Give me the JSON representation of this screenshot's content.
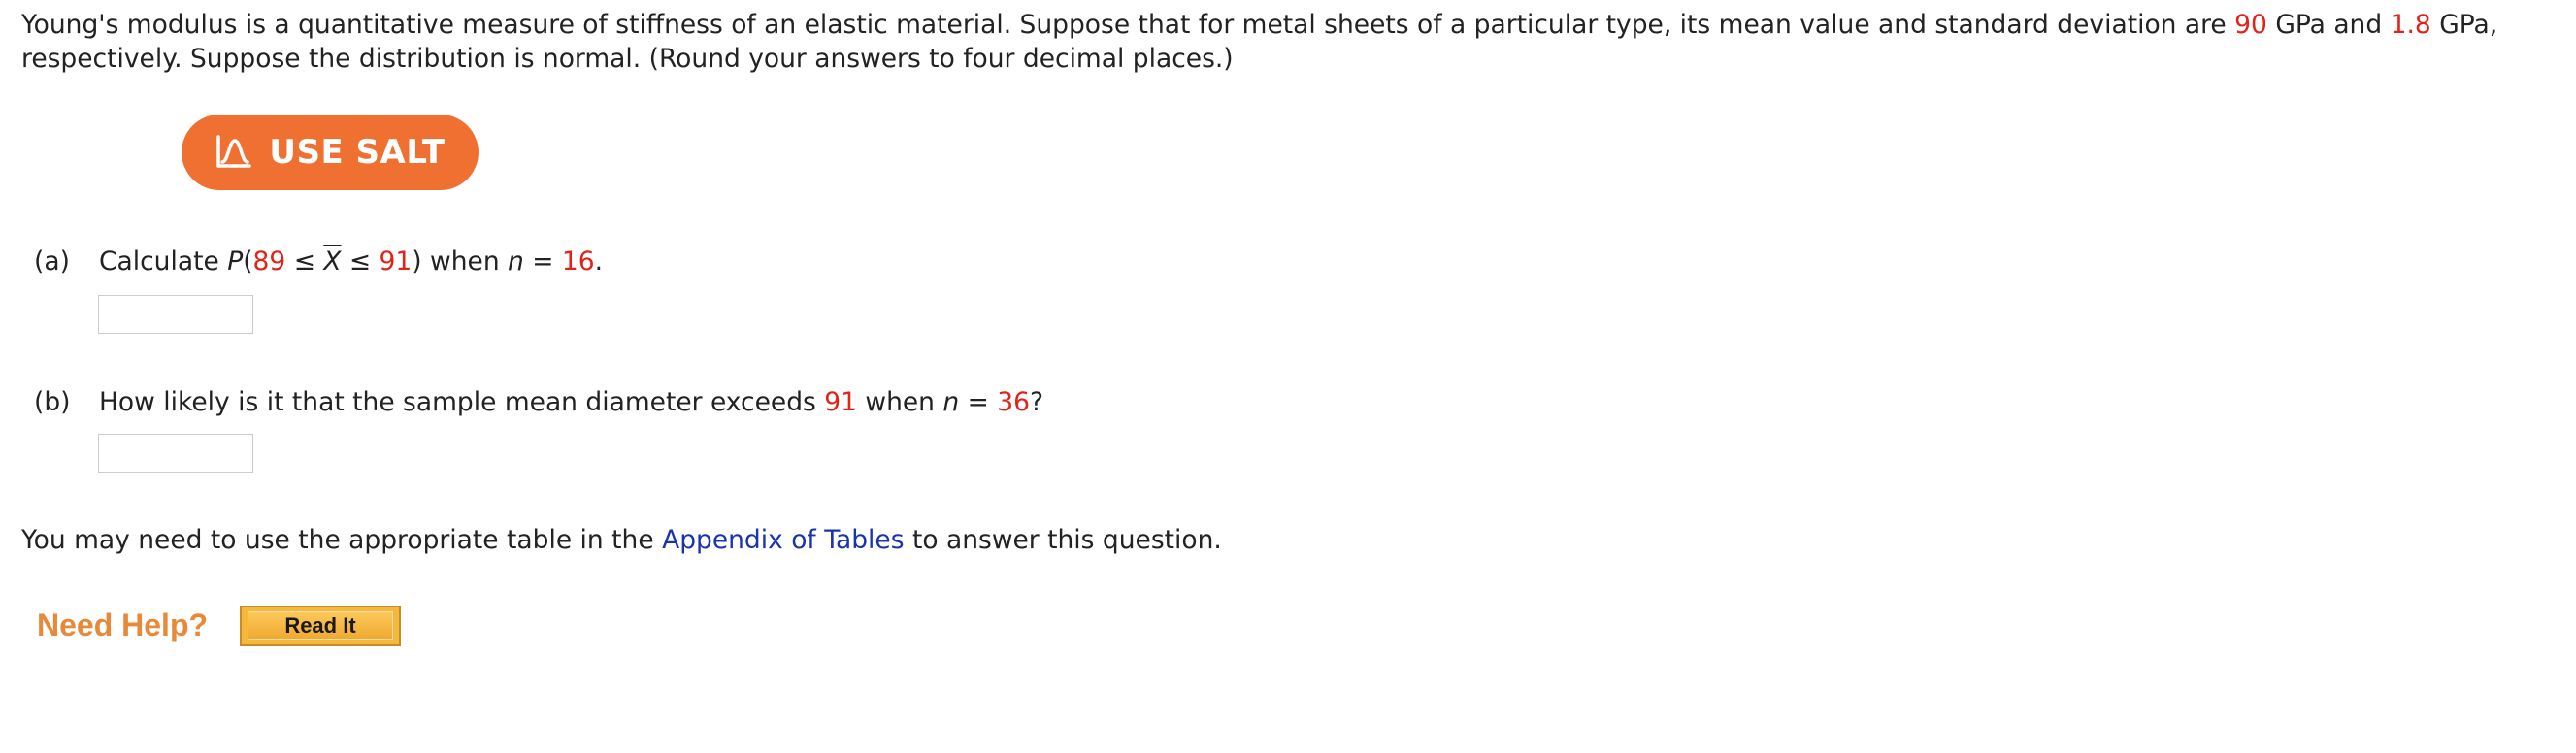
{
  "intro": {
    "text_1": "Young's modulus is a quantitative measure of stiffness of an elastic material. Suppose that for metal sheets of a particular type, its mean value and standard deviation are ",
    "mean": "90",
    "text_2": " GPa and ",
    "sd": "1.8",
    "text_3": " GPa, respectively. Suppose the distribution is normal. (Round your answers to four decimal places.)"
  },
  "salt_button": {
    "label": "USE SALT",
    "icon": "salt-chart-icon"
  },
  "part_a": {
    "label": "(a)",
    "text_1": "Calculate ",
    "p": "P",
    "paren_open": "(",
    "lower": "89",
    "le_1": " ≤ ",
    "xbar": "X",
    "le_2": " ≤ ",
    "upper": "91",
    "paren_close": ")",
    "text_2": " when ",
    "n_var": "n",
    "eq": " = ",
    "n_value": "16",
    "text_3": ".",
    "answer_value": ""
  },
  "part_b": {
    "label": "(b)",
    "text_1": "How likely is it that the sample mean diameter exceeds ",
    "threshold": "91",
    "text_2": " when ",
    "n_var": "n",
    "eq": " = ",
    "n_value": "36",
    "text_3": "?",
    "answer_value": ""
  },
  "tables_note": {
    "text_1": "You may need to use the appropriate table in the ",
    "link": "Appendix of Tables",
    "text_2": " to answer this question."
  },
  "help": {
    "label": "Need Help?",
    "read_it": "Read It"
  },
  "colors": {
    "highlight": "#e2231a",
    "salt_orange": "#ef7030",
    "link_blue": "#1a33b0",
    "help_orange": "#e8893a"
  }
}
